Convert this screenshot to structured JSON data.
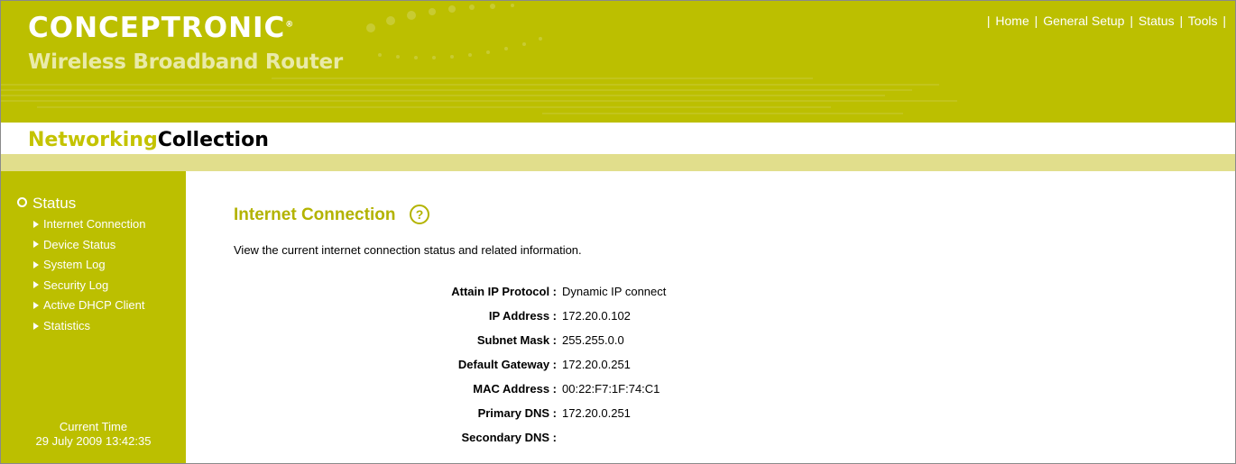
{
  "header": {
    "logo_text": "CONCEPTRONIC",
    "logo_mark": "®",
    "subtitle": "Wireless Broadband Router",
    "nav": [
      {
        "label": "Home"
      },
      {
        "label": "General Setup"
      },
      {
        "label": "Status"
      },
      {
        "label": "Tools"
      }
    ],
    "bg_color": "#bcbf00"
  },
  "brand": {
    "part1": "Networking",
    "part2": "Collection",
    "part1_color": "#c4c300",
    "part2_color": "#000000"
  },
  "sidebar": {
    "section_icon": "radio-circle-icon",
    "section_title": "Status",
    "items": [
      {
        "label": "Internet Connection",
        "icon": "triangle-bullet-icon"
      },
      {
        "label": "Device Status",
        "icon": "triangle-bullet-icon"
      },
      {
        "label": "System Log",
        "icon": "triangle-bullet-icon"
      },
      {
        "label": "Security Log",
        "icon": "triangle-bullet-icon"
      },
      {
        "label": "Active DHCP Client",
        "icon": "triangle-bullet-icon"
      },
      {
        "label": "Statistics",
        "icon": "triangle-bullet-icon"
      }
    ],
    "current_time_label": "Current Time",
    "current_time_value": "29 July 2009 13:42:35"
  },
  "main": {
    "title": "Internet Connection",
    "help_icon": "help-question-icon",
    "description": "View the current internet connection status and related information.",
    "rows": [
      {
        "label": "Attain IP Protocol :",
        "value": "Dynamic IP connect"
      },
      {
        "label": "IP Address :",
        "value": "172.20.0.102"
      },
      {
        "label": "Subnet Mask :",
        "value": "255.255.0.0"
      },
      {
        "label": "Default Gateway :",
        "value": "172.20.0.251"
      },
      {
        "label": "MAC Address :",
        "value": "00:22:F7:1F:74:C1"
      },
      {
        "label": "Primary DNS :",
        "value": "172.20.0.251"
      },
      {
        "label": "Secondary DNS :",
        "value": ""
      }
    ],
    "title_color": "#b3b300"
  }
}
